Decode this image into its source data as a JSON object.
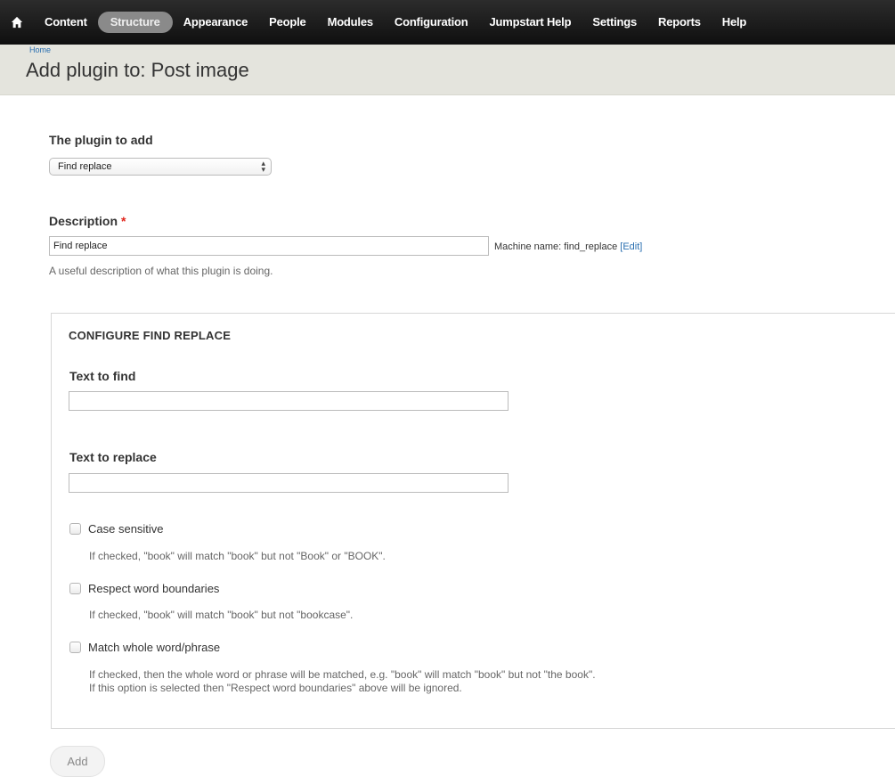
{
  "toolbar": {
    "items": [
      {
        "label": "Content"
      },
      {
        "label": "Structure",
        "active": true
      },
      {
        "label": "Appearance"
      },
      {
        "label": "People"
      },
      {
        "label": "Modules"
      },
      {
        "label": "Configuration"
      },
      {
        "label": "Jumpstart Help"
      },
      {
        "label": "Settings"
      },
      {
        "label": "Reports"
      },
      {
        "label": "Help"
      }
    ],
    "home_icon": "home-icon"
  },
  "header": {
    "breadcrumb": "Home",
    "title": "Add plugin to: Post image"
  },
  "form": {
    "plugin": {
      "label": "The plugin to add",
      "selected": "Find replace"
    },
    "description": {
      "label": "Description",
      "required_mark": "*",
      "value": "Find replace",
      "machine_name_prefix": "Machine name: find_replace",
      "edit_open": "[",
      "edit_label": "Edit",
      "edit_close": "]",
      "help": "A useful description of what this plugin is doing."
    },
    "configure": {
      "legend": "CONFIGURE FIND REPLACE",
      "text_to_find": {
        "label": "Text to find",
        "value": ""
      },
      "text_to_replace": {
        "label": "Text to replace",
        "value": ""
      },
      "options": [
        {
          "label": "Case sensitive",
          "checked": false,
          "description": "If checked, \"book\" will match \"book\" but not \"Book\" or \"BOOK\"."
        },
        {
          "label": "Respect word boundaries",
          "checked": false,
          "description": "If checked, \"book\" will match \"book\" but not \"bookcase\"."
        },
        {
          "label": "Match whole word/phrase",
          "checked": false,
          "description": "If checked, then the whole word or phrase will be matched, e.g. \"book\" will match \"book\" but not \"the book\".",
          "description2": "If this option is selected then \"Respect word boundaries\" above will be ignored."
        }
      ]
    },
    "submit_label": "Add"
  }
}
